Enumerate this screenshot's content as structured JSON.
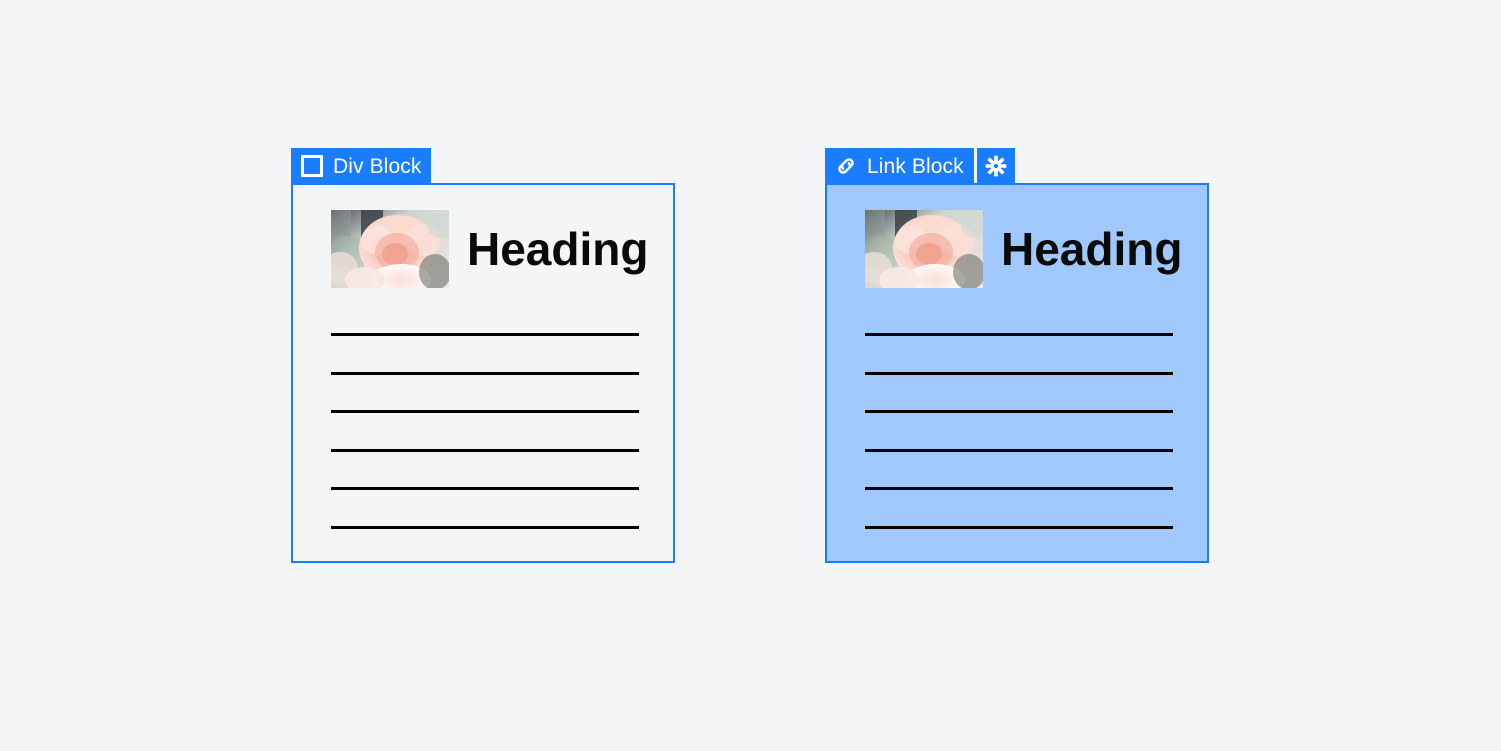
{
  "page": {
    "background_color": "#f4f5f7",
    "accent_color": "#1a7cff",
    "blue_fill_color": "#a0c8fc",
    "rule_color": "#000000",
    "heading_color": "#0a0a0a"
  },
  "blocks": [
    {
      "id": "div-block",
      "tab": {
        "label": "Div Block",
        "icon": "square-frame-icon",
        "has_gear": false,
        "gear_icon": ""
      },
      "body": {
        "fill": "none",
        "border_color": "#1a7cff"
      },
      "content": {
        "image_alt": "pink-peony-flower-photo",
        "heading": "Heading",
        "rule_count": 6
      }
    },
    {
      "id": "link-block",
      "tab": {
        "label": "Link Block",
        "icon": "chain-link-icon",
        "has_gear": true,
        "gear_icon": "gear-icon"
      },
      "body": {
        "fill": "#a0c8fc",
        "border_color": "#1a7cff"
      },
      "content": {
        "image_alt": "pink-peony-flower-photo",
        "heading": "Heading",
        "rule_count": 6
      }
    }
  ]
}
